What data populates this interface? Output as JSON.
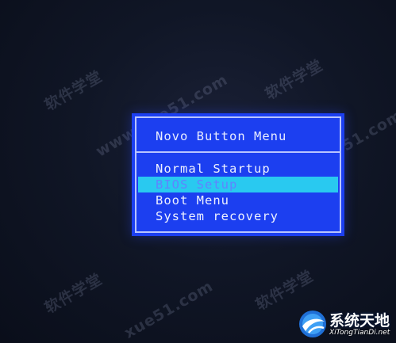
{
  "menu": {
    "title": "Novo Button Menu",
    "items": [
      {
        "label": "Normal Startup"
      },
      {
        "label": "BIOS Setup"
      },
      {
        "label": "Boot Menu"
      },
      {
        "label": "System recovery"
      }
    ],
    "selected_index": 1
  },
  "watermarks": {
    "brand_cn": "软件学堂",
    "domain": "www.xue51.com",
    "domain_short": "xue51.com"
  },
  "logo": {
    "name": "系统天地",
    "site": "XiTongTianDi.net"
  },
  "colors": {
    "menu_bg": "#1c3ff0",
    "highlight": "#29c9f0",
    "menu_text": "#eef1ff"
  }
}
